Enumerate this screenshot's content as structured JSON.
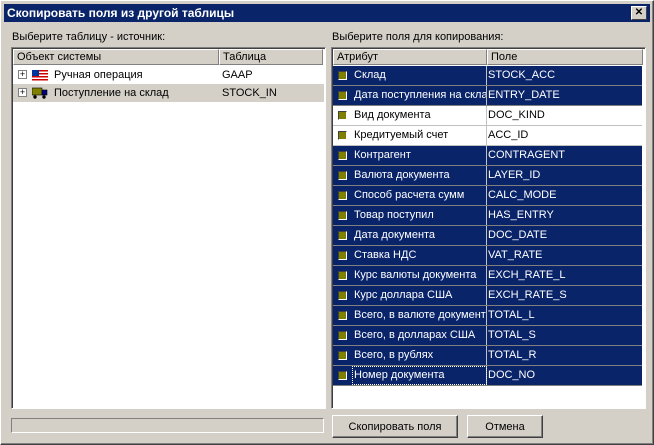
{
  "window": {
    "title": "Скопировать поля из другой таблицы",
    "close_glyph": "✕"
  },
  "left": {
    "label": "Выберите таблицу - источник:",
    "columns": [
      "Объект системы",
      "Таблица"
    ],
    "rows": [
      {
        "icon": "us-flag-icon",
        "name": "Ручная операция",
        "table": "GAAP",
        "selected": false
      },
      {
        "icon": "truck-icon",
        "name": "Поступление на склад",
        "table": "STOCK_IN",
        "selected": true
      }
    ]
  },
  "right": {
    "label": "Выберите поля для копирования:",
    "columns": [
      "Атрибут",
      "Поле"
    ],
    "rows": [
      {
        "attr": "Склад",
        "field": "STOCK_ACC",
        "checked": true
      },
      {
        "attr": "Дата поступления на склад",
        "field": "ENTRY_DATE",
        "checked": true
      },
      {
        "attr": "Вид документа",
        "field": "DOC_KIND",
        "checked": false
      },
      {
        "attr": "Кредитуемый счет",
        "field": "ACC_ID",
        "checked": false
      },
      {
        "attr": "Контрагент",
        "field": "CONTRAGENT",
        "checked": true
      },
      {
        "attr": "Валюта документа",
        "field": "LAYER_ID",
        "checked": true
      },
      {
        "attr": "Способ расчета сумм",
        "field": "CALC_MODE",
        "checked": true
      },
      {
        "attr": "Товар поступил",
        "field": "HAS_ENTRY",
        "checked": true
      },
      {
        "attr": "Дата документа",
        "field": "DOC_DATE",
        "checked": true
      },
      {
        "attr": "Ставка НДС",
        "field": "VAT_RATE",
        "checked": true
      },
      {
        "attr": "Курс валюты документа",
        "field": "EXCH_RATE_L",
        "checked": true
      },
      {
        "attr": "Курс доллара США",
        "field": "EXCH_RATE_S",
        "checked": true
      },
      {
        "attr": "Всего, в валюте документа",
        "field": "TOTAL_L",
        "checked": true
      },
      {
        "attr": "Всего, в долларах США",
        "field": "TOTAL_S",
        "checked": true
      },
      {
        "attr": "Всего, в рублях",
        "field": "TOTAL_R",
        "checked": true
      },
      {
        "attr": "Номер документа",
        "field": "DOC_NO",
        "checked": true
      }
    ]
  },
  "buttons": {
    "copy": "Скопировать поля",
    "cancel": "Отмена"
  },
  "colors": {
    "selection": "#0a246a",
    "checkbox": "#808000",
    "face": "#d4d0c8"
  }
}
